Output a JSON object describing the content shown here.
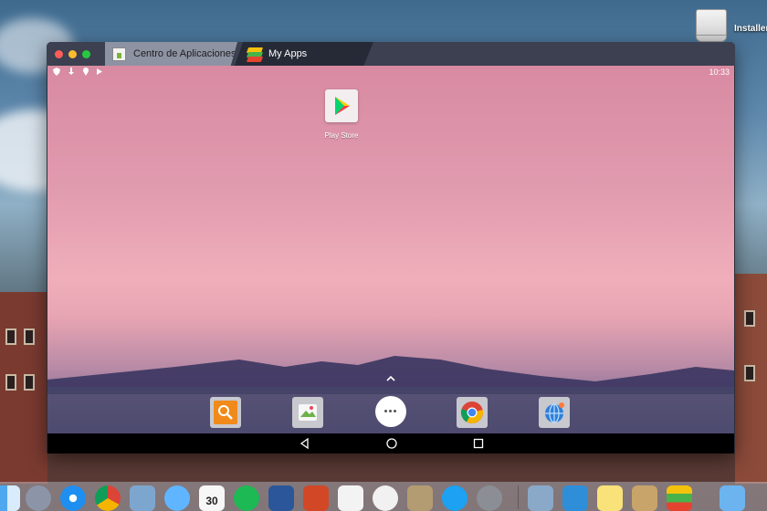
{
  "desktop": {
    "drive_label": "Installer"
  },
  "window": {
    "tabs": [
      {
        "label": "Centro de Aplicaciones",
        "icon": "app-center-icon",
        "active": false
      },
      {
        "label": "My Apps",
        "icon": "bluestacks-icon",
        "active": true
      }
    ]
  },
  "android": {
    "status": {
      "time": "10:33",
      "icons": [
        "shield-icon",
        "download-icon",
        "location-icon",
        "play-protect-icon"
      ]
    },
    "home_apps": [
      {
        "label": "Play Store",
        "icon": "play-store-icon"
      }
    ],
    "dock_apps": [
      "search-app-icon",
      "gallery-app-icon",
      "app-drawer-icon",
      "chrome-icon",
      "browser-globe-icon"
    ],
    "nav": [
      "back-icon",
      "home-icon",
      "recents-icon"
    ]
  },
  "mac_dock": {
    "calendar_day": "30",
    "icons": [
      "finder-icon",
      "launchpad-icon",
      "safari-icon",
      "chrome-icon",
      "preview-icon",
      "messages-icon",
      "calendar-icon",
      "spotify-icon",
      "word-icon",
      "powerpoint-icon",
      "ia-writer-icon",
      "slack-icon",
      "archive-icon",
      "twitter-icon",
      "system-preferences-icon",
      "image-capture-icon",
      "markdown-icon",
      "notes-icon",
      "box-icon",
      "bluestacks-icon",
      "folder-icon"
    ]
  },
  "colors": {
    "window_chrome": "#3c4050",
    "active_tab": "#262a36",
    "navbar": "#000000",
    "dock_bar": "#464669"
  }
}
